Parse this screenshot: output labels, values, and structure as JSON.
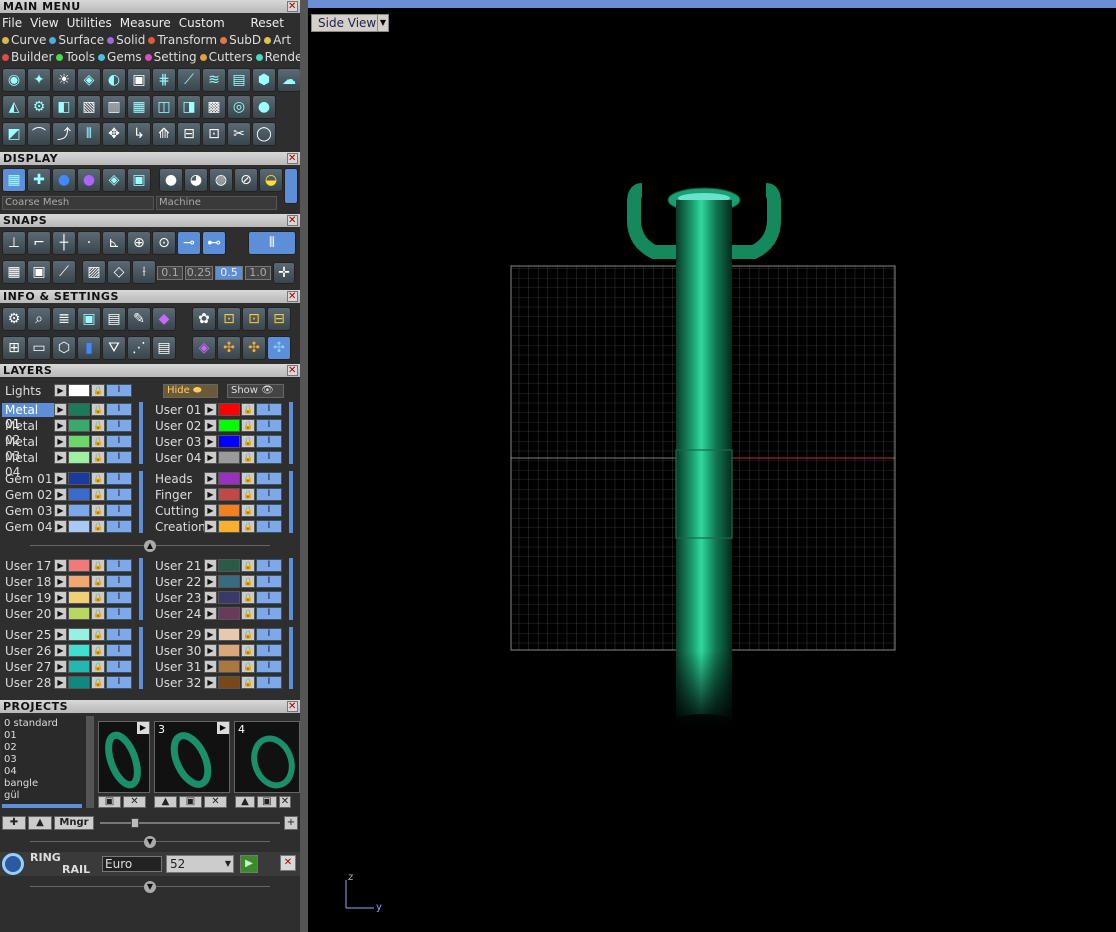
{
  "main_menu": {
    "title": "MAIN MENU",
    "items": [
      "File",
      "View",
      "Utilities",
      "Measure",
      "Custom"
    ],
    "reset": "Reset",
    "cats1": [
      {
        "label": "Curve",
        "color": "#d9b84a"
      },
      {
        "label": "Surface",
        "color": "#4ab0d9"
      },
      {
        "label": "Solid",
        "color": "#9b6ae0"
      },
      {
        "label": "Transform",
        "color": "#e05a3a"
      },
      {
        "label": "SubD",
        "color": "#e07a4a"
      },
      {
        "label": "Art",
        "color": "#e0c04a"
      }
    ],
    "cats2": [
      {
        "label": "Builder",
        "color": "#e04a4a"
      },
      {
        "label": "Tools",
        "color": "#4ad94a"
      },
      {
        "label": "Gems",
        "color": "#4ac0e0"
      },
      {
        "label": "Setting",
        "color": "#e04ac0"
      },
      {
        "label": "Cutters",
        "color": "#e0a040"
      },
      {
        "label": "Render",
        "color": "#4ad9c0"
      }
    ]
  },
  "display": {
    "title": "DISPLAY",
    "mesh": "Coarse Mesh",
    "mode": "Machine"
  },
  "snaps": {
    "title": "SNAPS",
    "values": [
      "0.1",
      "0.25",
      "0.5",
      "1.0"
    ]
  },
  "info": {
    "title": "INFO & SETTINGS"
  },
  "layers": {
    "title": "LAYERS",
    "lights": "Lights",
    "hide": "Hide",
    "show": "Show"
  },
  "projects": {
    "title": "PROJECTS",
    "list": [
      "0 standard",
      "01",
      "02",
      "03",
      "04",
      "bangle",
      "gül"
    ],
    "thumb_nums": [
      "3",
      "4"
    ],
    "mngr": "Mngr"
  },
  "ring": {
    "line1": "RING",
    "line2": "RAIL",
    "unit": "Euro",
    "size": "52"
  },
  "viewport": {
    "label": "Side View",
    "axis_z": "z",
    "axis_y": "y"
  }
}
